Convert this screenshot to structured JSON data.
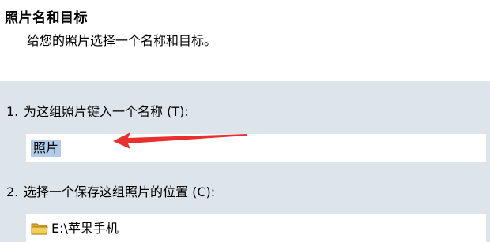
{
  "header": {
    "title": "照片名和目标",
    "subtitle": "给您的照片选择一个名称和目标。"
  },
  "step1": {
    "number": "1.",
    "label": "为这组照片键入一个名称",
    "accel": "(T):",
    "value": "照片"
  },
  "step2": {
    "number": "2.",
    "label": "选择一个保存这组照片的位置",
    "accel": "(C):",
    "path": "E:\\苹果手机"
  },
  "colors": {
    "panel": "#dde4ea",
    "selection": "#b2cbe8",
    "arrow": "#e8312f",
    "folder": "#f2c744"
  }
}
